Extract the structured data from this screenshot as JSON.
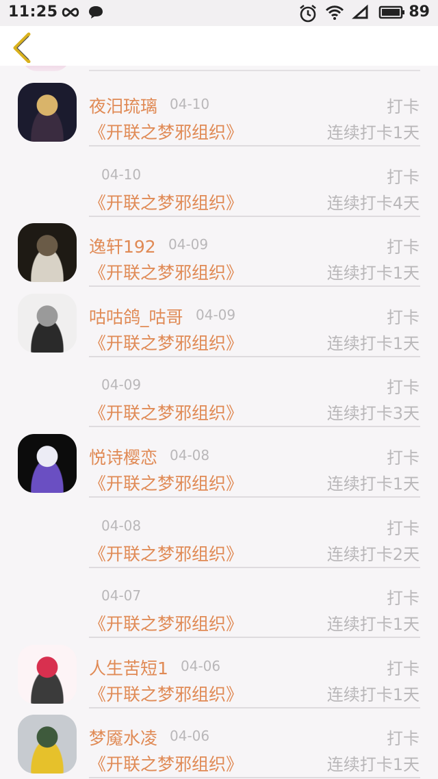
{
  "status_bar": {
    "time": "11:25",
    "battery": "89"
  },
  "nav": {
    "back_icon": "chevron-left-icon"
  },
  "rows": [
    {
      "name": "夜汨琉璃",
      "date": "04-10",
      "action": "打卡",
      "group": "《开联之梦邪组织》",
      "streak": "连续打卡1天",
      "has_avatar": true,
      "avatar_colors": [
        "#1b1b2e",
        "#d9b46a",
        "#3a2c40"
      ]
    },
    {
      "name": "",
      "date": "04-10",
      "action": "打卡",
      "group": "《开联之梦邪组织》",
      "streak": "连续打卡4天",
      "has_avatar": false
    },
    {
      "name": "逸轩192",
      "date": "04-09",
      "action": "打卡",
      "group": "《开联之梦邪组织》",
      "streak": "连续打卡1天",
      "has_avatar": true,
      "avatar_colors": [
        "#1e1a14",
        "#6a5b47",
        "#d8d2c6"
      ]
    },
    {
      "name": "咕咕鸽_咕哥",
      "date": "04-09",
      "action": "打卡",
      "group": "《开联之梦邪组织》",
      "streak": "连续打卡1天",
      "has_avatar": true,
      "avatar_colors": [
        "#f0efef",
        "#9a9a9a",
        "#2a2a2a"
      ]
    },
    {
      "name": "",
      "date": "04-09",
      "action": "打卡",
      "group": "《开联之梦邪组织》",
      "streak": "连续打卡3天",
      "has_avatar": false
    },
    {
      "name": "悦诗樱恋",
      "date": "04-08",
      "action": "打卡",
      "group": "《开联之梦邪组织》",
      "streak": "连续打卡1天",
      "has_avatar": true,
      "avatar_colors": [
        "#0c0c0c",
        "#ececf5",
        "#6a4fc2"
      ]
    },
    {
      "name": "",
      "date": "04-08",
      "action": "打卡",
      "group": "《开联之梦邪组织》",
      "streak": "连续打卡2天",
      "has_avatar": false
    },
    {
      "name": "",
      "date": "04-07",
      "action": "打卡",
      "group": "《开联之梦邪组织》",
      "streak": "连续打卡1天",
      "has_avatar": false
    },
    {
      "name": "人生苦短1",
      "date": "04-06",
      "action": "打卡",
      "group": "《开联之梦邪组织》",
      "streak": "连续打卡1天",
      "has_avatar": true,
      "avatar_colors": [
        "#fdf4f6",
        "#d8304f",
        "#3b3b3b"
      ]
    },
    {
      "name": "梦魇水凌",
      "date": "04-06",
      "action": "打卡",
      "group": "《开联之梦邪组织》",
      "streak": "连续打卡1天",
      "has_avatar": true,
      "avatar_colors": [
        "#c7cbd0",
        "#3e5a3c",
        "#e6c12b"
      ]
    }
  ],
  "colors": {
    "accent": "#e08a55",
    "muted": "#b9b7b9",
    "divider": "#dedbde",
    "back_icon": "#d9b11e"
  }
}
